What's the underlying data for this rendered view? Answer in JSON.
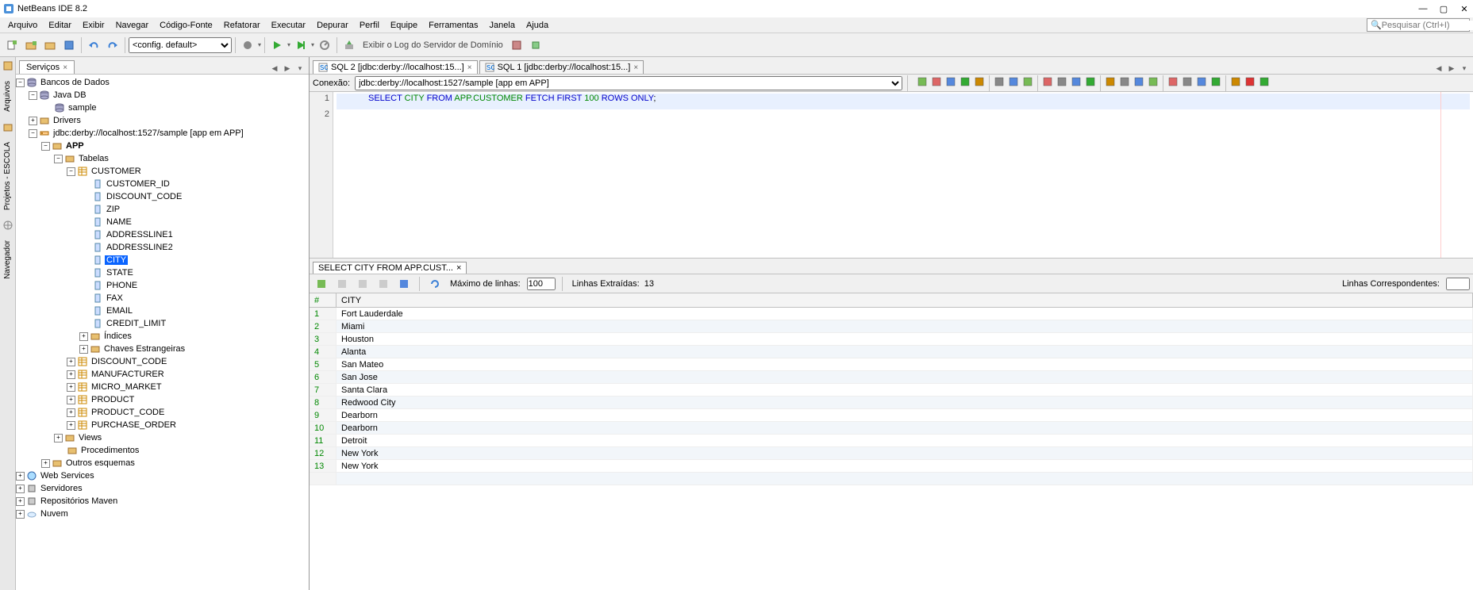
{
  "title": "NetBeans IDE 8.2",
  "search_placeholder": "Pesquisar (Ctrl+I)",
  "menu": [
    "Arquivo",
    "Editar",
    "Exibir",
    "Navegar",
    "Código-Fonte",
    "Refatorar",
    "Executar",
    "Depurar",
    "Perfil",
    "Equipe",
    "Ferramentas",
    "Janela",
    "Ajuda"
  ],
  "toolbar": {
    "config": "<config. default>",
    "logtext": "Exibir o Log do Servidor de Domínio"
  },
  "leftdock": [
    "Arquivos",
    "Projetos - ESCOLA",
    "Navegador"
  ],
  "side": {
    "tab": "Serviços",
    "tree": {
      "root": "Bancos de Dados",
      "javadb": "Java DB",
      "sample": "sample",
      "drivers": "Drivers",
      "conn": "jdbc:derby://localhost:1527/sample [app em APP]",
      "app": "APP",
      "tabelas": "Tabelas",
      "customer": "CUSTOMER",
      "cols": [
        "CUSTOMER_ID",
        "DISCOUNT_CODE",
        "ZIP",
        "NAME",
        "ADDRESSLINE1",
        "ADDRESSLINE2",
        "CITY",
        "STATE",
        "PHONE",
        "FAX",
        "EMAIL",
        "CREDIT_LIMIT"
      ],
      "indices": "Índices",
      "fk": "Chaves Estrangeiras",
      "tables2": [
        "DISCOUNT_CODE",
        "MANUFACTURER",
        "MICRO_MARKET",
        "PRODUCT",
        "PRODUCT_CODE",
        "PURCHASE_ORDER"
      ],
      "views": "Views",
      "procs": "Procedimentos",
      "other": "Outros esquemas",
      "after": [
        "Web Services",
        "Servidores",
        "Repositórios Maven",
        "Nuvem"
      ]
    }
  },
  "editor": {
    "tabs": [
      "SQL 2 [jdbc:derby://localhost:15...]",
      "SQL 1 [jdbc:derby://localhost:15...]"
    ],
    "conn_label": "Conexão:",
    "conn_value": "jdbc:derby://localhost:1527/sample [app em APP]",
    "code_tokens": [
      {
        "t": "SELECT",
        "c": "kw"
      },
      {
        "t": " "
      },
      {
        "t": "CITY",
        "c": "id"
      },
      {
        "t": " "
      },
      {
        "t": "FROM",
        "c": "kw"
      },
      {
        "t": " "
      },
      {
        "t": "APP.CUSTOMER",
        "c": "id"
      },
      {
        "t": " "
      },
      {
        "t": "FETCH",
        "c": "kw"
      },
      {
        "t": " "
      },
      {
        "t": "FIRST",
        "c": "kw"
      },
      {
        "t": " "
      },
      {
        "t": "100",
        "c": "num"
      },
      {
        "t": " "
      },
      {
        "t": "ROWS",
        "c": "kw"
      },
      {
        "t": " "
      },
      {
        "t": "ONLY",
        "c": "kw"
      },
      {
        "t": ";"
      }
    ],
    "gutter": [
      "1",
      "2"
    ]
  },
  "result": {
    "tab": "SELECT CITY FROM APP.CUST...",
    "maxlabel": "Máximo de linhas:",
    "maxval": "100",
    "extracted_label": "Linhas Extraídas:",
    "extracted_val": "13",
    "match_label": "Linhas Correspondentes:",
    "col_num": "#",
    "col_city": "CITY",
    "rows": [
      {
        "n": "1",
        "c": "Fort Lauderdale"
      },
      {
        "n": "2",
        "c": "Miami"
      },
      {
        "n": "3",
        "c": "Houston"
      },
      {
        "n": "4",
        "c": "Alanta"
      },
      {
        "n": "5",
        "c": "San Mateo"
      },
      {
        "n": "6",
        "c": "San Jose"
      },
      {
        "n": "7",
        "c": "Santa Clara"
      },
      {
        "n": "8",
        "c": "Redwood City"
      },
      {
        "n": "9",
        "c": "Dearborn"
      },
      {
        "n": "10",
        "c": "Dearborn"
      },
      {
        "n": "11",
        "c": "Detroit"
      },
      {
        "n": "12",
        "c": "New York"
      },
      {
        "n": "13",
        "c": "New York"
      }
    ]
  }
}
